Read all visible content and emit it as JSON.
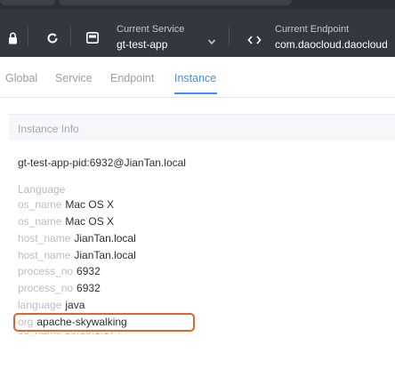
{
  "header": {
    "service_label": "Current Service",
    "service_value": "gt-test-app",
    "endpoint_label": "Current Endpoint",
    "endpoint_value": "com.daocloud.daocloud"
  },
  "tabs": [
    {
      "label": "Global",
      "active": false
    },
    {
      "label": "Service",
      "active": false
    },
    {
      "label": "Endpoint",
      "active": false
    },
    {
      "label": "Instance",
      "active": true
    }
  ],
  "panel": {
    "title": "Instance Info",
    "instance_name": "gt-test-app-pid:6932@JianTan.local",
    "attributes_heading": "Language",
    "attributes": [
      {
        "key": "os_name",
        "value": "Mac OS X"
      },
      {
        "key": "os_name",
        "value": "Mac OS X"
      },
      {
        "key": "host_name",
        "value": "JianTan.local"
      },
      {
        "key": "host_name",
        "value": "JianTan.local"
      },
      {
        "key": "process_no",
        "value": "6932"
      },
      {
        "key": "process_no",
        "value": "6932"
      },
      {
        "key": "language",
        "value": "java"
      },
      {
        "key": "org",
        "value": "apache-skywalking"
      }
    ]
  },
  "colors": {
    "header_bg": "#333840",
    "accent": "#448dfe",
    "highlight_border": "#e0632c"
  },
  "icons": {
    "icon1": "lock-icon",
    "icon2": "refresh-icon",
    "icon3": "service-icon",
    "icon4": "chevron-down-icon",
    "icon5": "code-icon"
  }
}
